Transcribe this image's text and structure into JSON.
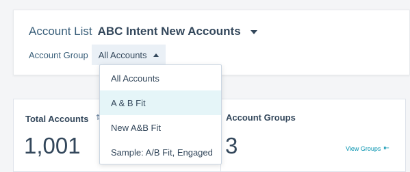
{
  "header": {
    "account_list_label": "Account List",
    "account_list_name": "ABC Intent New Accounts",
    "account_group_label": "Account Group",
    "account_group_value": "All Accounts"
  },
  "dropdown": {
    "items": [
      "All Accounts",
      "A & B Fit",
      "New A&B Fit",
      "Sample: A/B Fit, Engaged"
    ],
    "hovered_index": 1
  },
  "stats": {
    "total_accounts_label": "Total Accounts",
    "total_accounts_value": "1,001",
    "account_groups_label": "Account Groups",
    "account_groups_value": "3",
    "view_groups_label": "View Groups"
  },
  "icons": {
    "list_caret": "chevron-down-icon",
    "group_caret": "chevron-up-icon",
    "sort": "sort-icon",
    "view_groups": "open-panel-icon"
  },
  "colors": {
    "accent": "#0091ae",
    "text": "#33475b",
    "hover": "#e5f5f8"
  }
}
